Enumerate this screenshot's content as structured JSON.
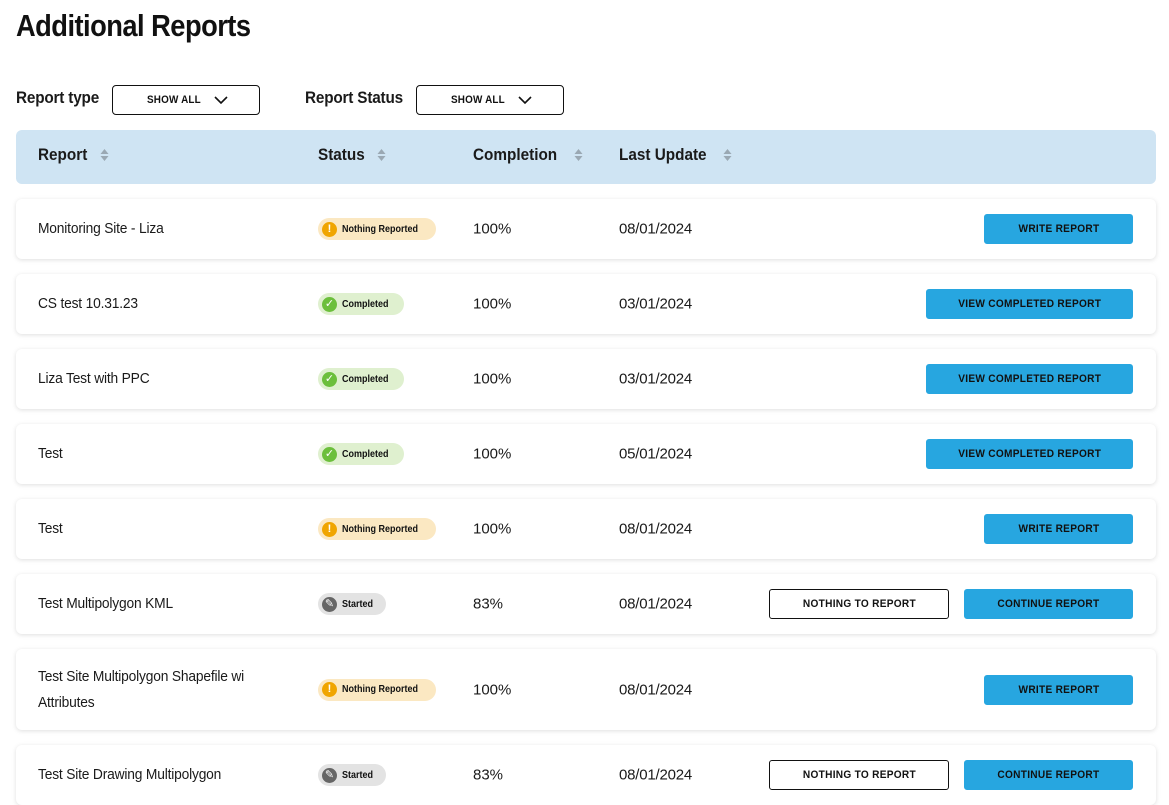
{
  "page": {
    "title": "Additional Reports"
  },
  "filters": {
    "report_type": {
      "label": "Report type",
      "value": "SHOW ALL"
    },
    "report_status": {
      "label": "Report Status",
      "value": "SHOW ALL"
    }
  },
  "table": {
    "columns": {
      "report": "Report",
      "status": "Status",
      "completion": "Completion",
      "last_update": "Last Update"
    },
    "rows": [
      {
        "name": "Monitoring Site - Liza",
        "status": "Nothing Reported",
        "status_kind": "nothing-reported",
        "completion": "100%",
        "last_update": "08/01/2024",
        "actions": {
          "primary": "WRITE REPORT"
        }
      },
      {
        "name": "CS test 10.31.23",
        "status": "Completed",
        "status_kind": "completed",
        "completion": "100%",
        "last_update": "03/01/2024",
        "actions": {
          "primary": "VIEW COMPLETED REPORT"
        }
      },
      {
        "name": "Liza Test with PPC",
        "status": "Completed",
        "status_kind": "completed",
        "completion": "100%",
        "last_update": "03/01/2024",
        "actions": {
          "primary": "VIEW COMPLETED REPORT"
        }
      },
      {
        "name": "Test",
        "status": "Completed",
        "status_kind": "completed",
        "completion": "100%",
        "last_update": "05/01/2024",
        "actions": {
          "primary": "VIEW COMPLETED REPORT"
        }
      },
      {
        "name": "Test",
        "status": "Nothing Reported",
        "status_kind": "nothing-reported",
        "completion": "100%",
        "last_update": "08/01/2024",
        "actions": {
          "primary": "WRITE REPORT"
        }
      },
      {
        "name": "Test Multipolygon KML",
        "status": "Started",
        "status_kind": "started",
        "completion": "83%",
        "last_update": "08/01/2024",
        "actions": {
          "secondary": "NOTHING TO REPORT",
          "primary": "CONTINUE REPORT"
        }
      },
      {
        "name": "Test Site Multipolygon Shapefile wi Attributes",
        "status": "Nothing Reported",
        "status_kind": "nothing-reported",
        "completion": "100%",
        "last_update": "08/01/2024",
        "actions": {
          "primary": "WRITE REPORT"
        }
      },
      {
        "name": "Test Site Drawing Multipolygon",
        "status": "Started",
        "status_kind": "started",
        "completion": "83%",
        "last_update": "08/01/2024",
        "actions": {
          "secondary": "NOTHING TO REPORT",
          "primary": "CONTINUE REPORT"
        }
      }
    ]
  },
  "icons": {
    "nothing-reported": "exclamation-circle-icon",
    "completed": "check-circle-icon",
    "started": "pencil-circle-icon",
    "filter_dropdown": "chevron-down-icon",
    "column_sort": "sort-icon"
  },
  "colors": {
    "header_bg": "#cfe4f3",
    "primary_button": "#27a6e0",
    "badge_nothing_reported_bg": "#fbe8c2",
    "badge_nothing_reported_icon": "#f0a500",
    "badge_completed_bg": "#dff0cf",
    "badge_completed_icon": "#6cbf3c",
    "badge_started_bg": "#e3e3e3",
    "badge_started_icon": "#666666"
  }
}
